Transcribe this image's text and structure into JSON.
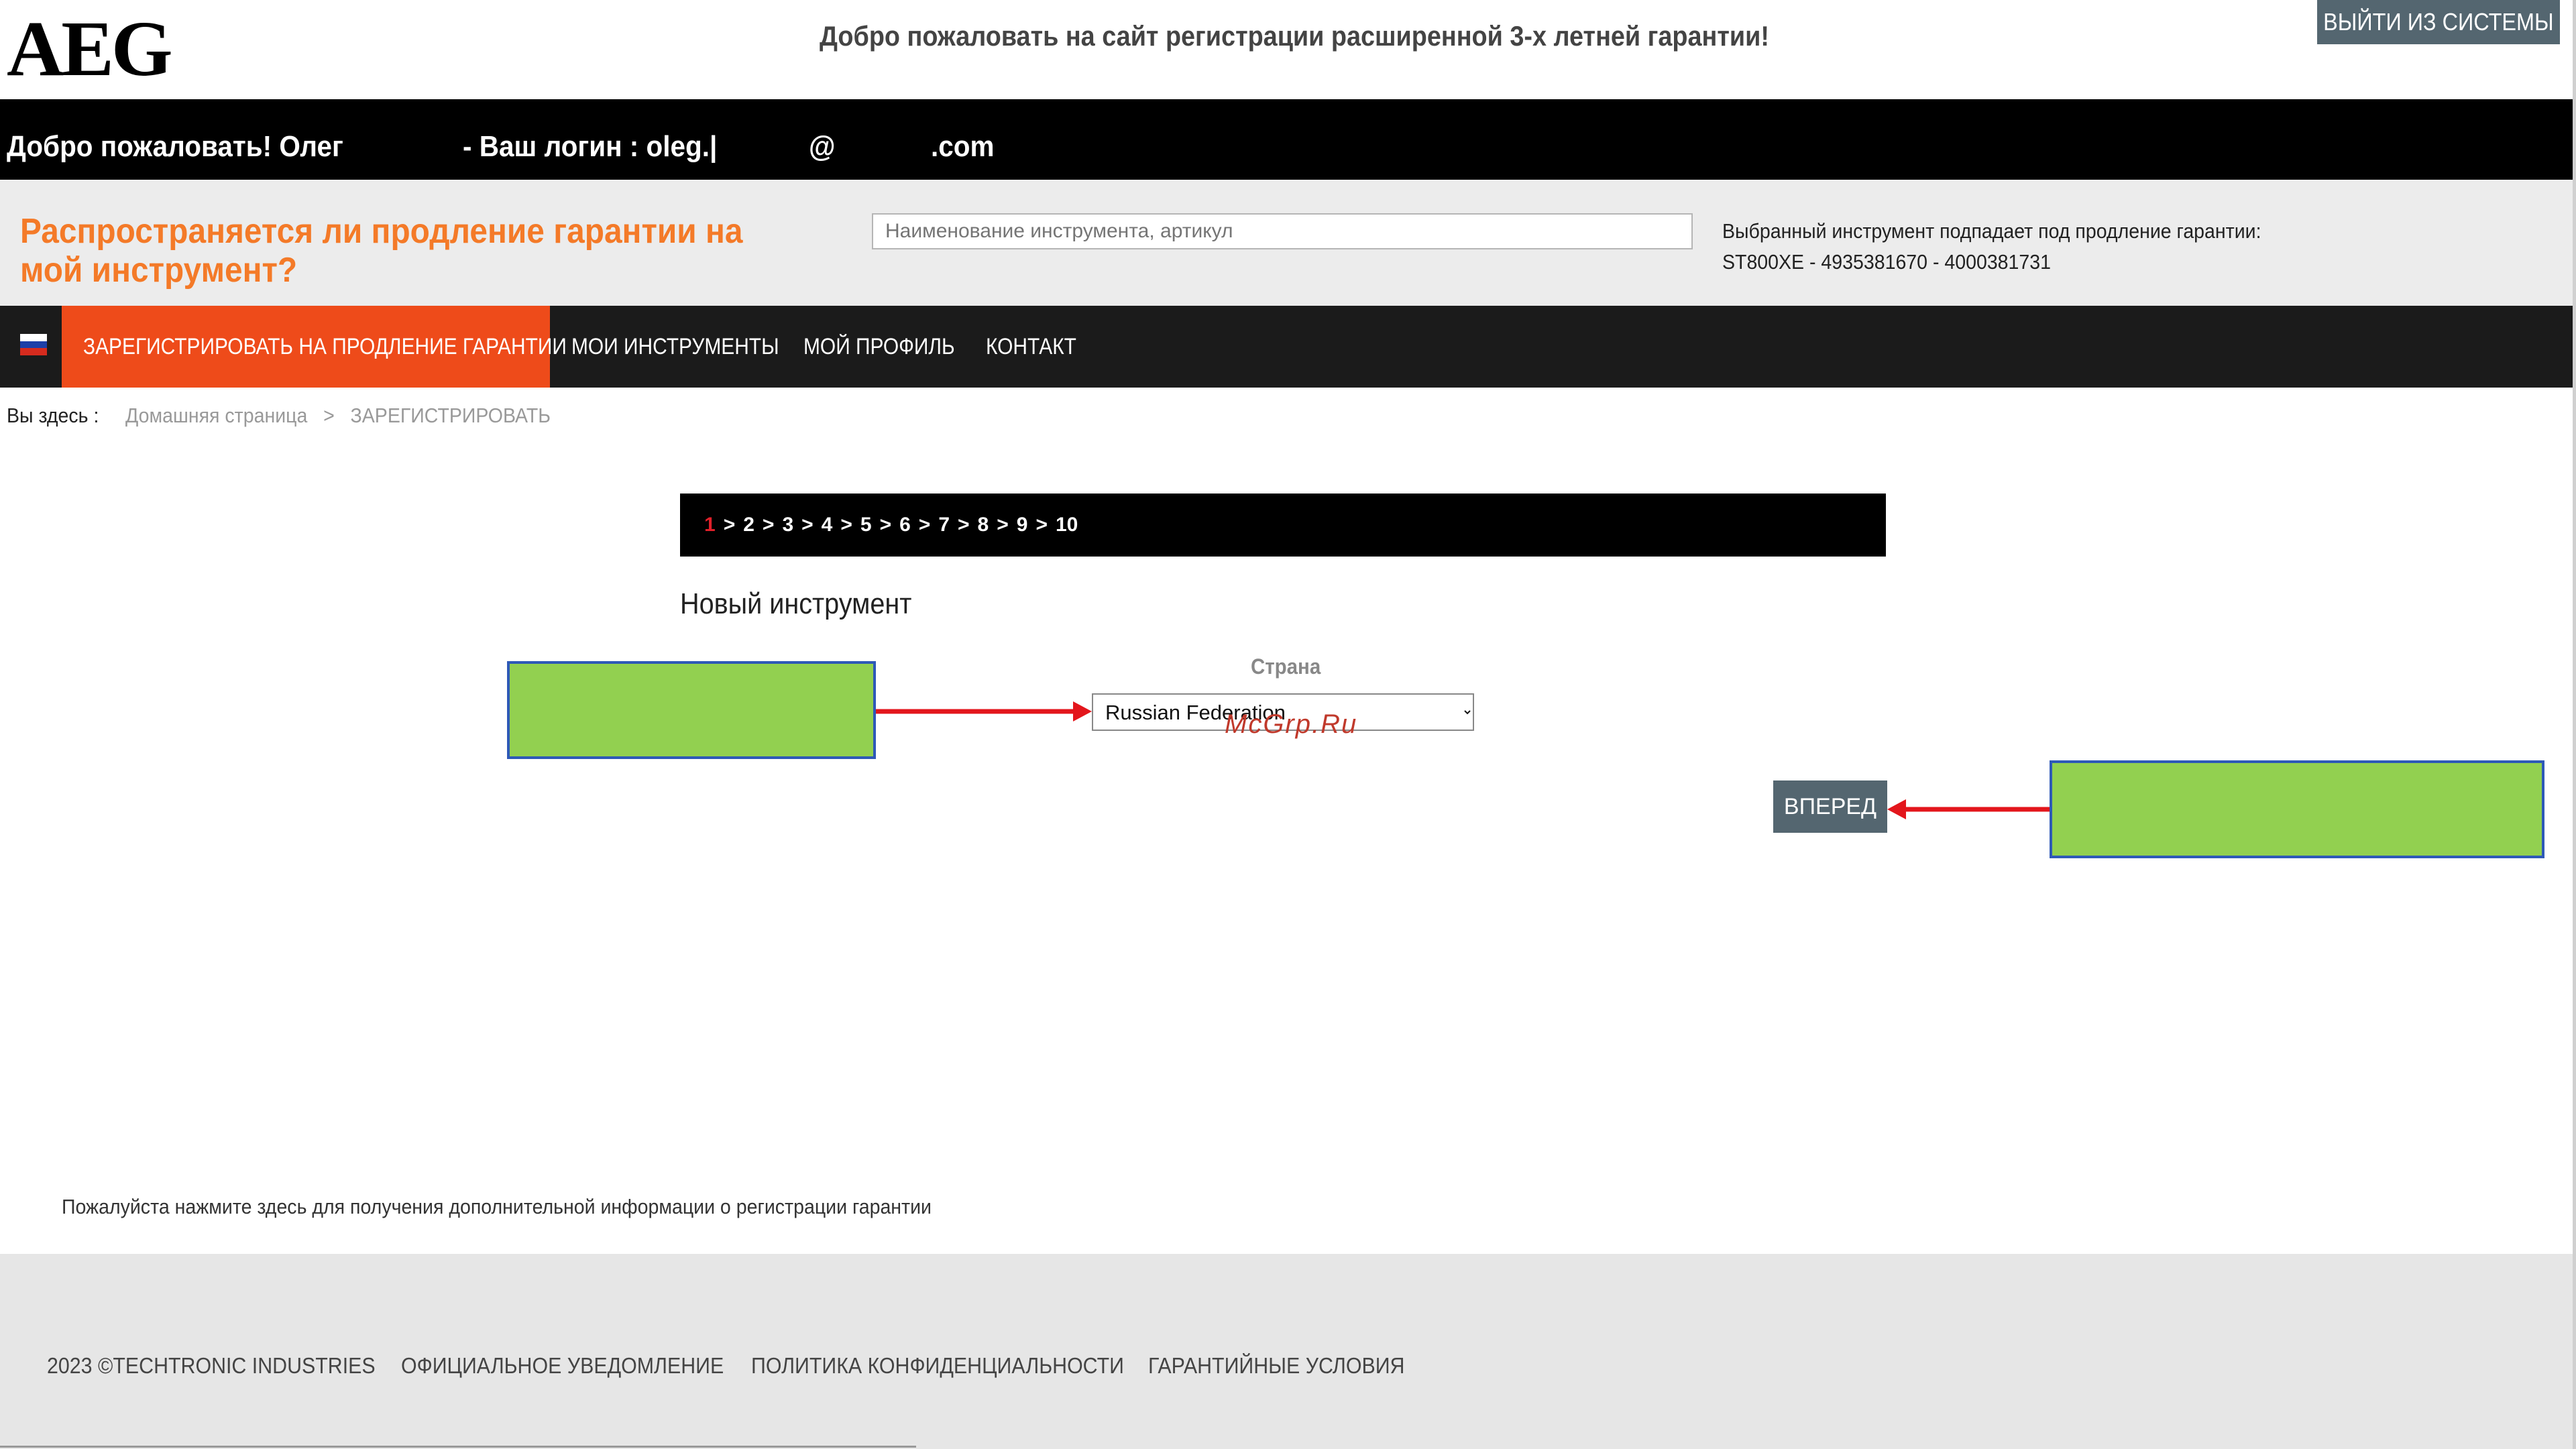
{
  "header": {
    "logo": "AEG",
    "welcome_title": "Добро пожаловать на сайт регистрации расширенной 3-х летней гарантии!",
    "logout_label": "ВЫЙТИ ИЗ СИСТЕМЫ"
  },
  "userbar": {
    "greeting": "Добро пожаловать! Олег",
    "login_label": "- Ваш логин : oleg.|",
    "at": "@",
    "domain": ".com"
  },
  "warranty_check": {
    "question": "Распространяется ли продление гарантии на мой инструмент?",
    "search_placeholder": "Наименование инструмента, артикул",
    "eligible_text": "Выбранный инструмент подпадает под продление гарантии:",
    "eligible_tool": "ST800XE - 4935381670 - 4000381731"
  },
  "nav": {
    "flag": "russia-flag-icon",
    "items": [
      {
        "label": "ЗАРЕГИСТРИРОВАТЬ НА ПРОДЛЕНИЕ ГАРАНТИИ",
        "active": true
      },
      {
        "label": "МОИ ИНСТРУМЕНТЫ"
      },
      {
        "label": "МОЙ ПРОФИЛЬ"
      },
      {
        "label": "КОНТАКТ"
      }
    ]
  },
  "breadcrumb": {
    "prefix": "Вы здесь :",
    "home": "Домашняя страница",
    "separator": ">",
    "current": "ЗАРЕГИСТРИРОВАТЬ"
  },
  "stepper": {
    "steps": [
      "1",
      "2",
      "3",
      "4",
      "5",
      "6",
      "7",
      "8",
      "9",
      "10"
    ],
    "separator": ">",
    "active_step": "1"
  },
  "form": {
    "section_title": "Новый инструмент",
    "country_label": "Страна",
    "country_value": "Russian Federation",
    "next_label": "ВПЕРЕД"
  },
  "watermark": "McGrp.Ru",
  "info_link": "Пожалуйста нажмите здесь для получения дополнительной информации о регистрации гарантии",
  "footer": {
    "copyright": "2023 ©TECHTRONIC INDUSTRIES",
    "links": [
      "ОФИЦИАЛЬНОЕ УВЕДОМЛЕНИЕ",
      "ПОЛИТИКА КОНФИДЕНЦИАЛЬНОСТИ",
      "ГАРАНТИЙНЫЕ УСЛОВИЯ"
    ]
  },
  "colors": {
    "accent_orange": "#f47a28",
    "nav_active": "#ee4b1a",
    "button_slate": "#546670",
    "annotation_green": "#92d050",
    "annotation_arrow": "#e3161c"
  }
}
